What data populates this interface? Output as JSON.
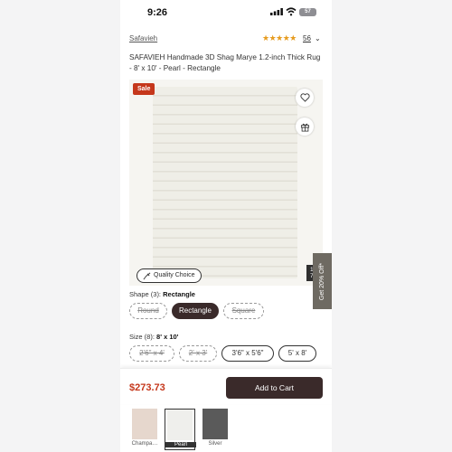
{
  "status_bar": {
    "time": "9:26",
    "battery": "57"
  },
  "product": {
    "brand": "Safavieh",
    "rating_stars": "★★★★★",
    "review_count": "56",
    "title": "SAFAVIEH Handmade 3D Shag Marye 1.2-inch Thick Rug - 8' x 10' - Pearl - Rectangle",
    "sale_badge": "Sale",
    "quality_badge": "Quality Choice",
    "image_counter": "1 / 7",
    "promo_tab": "Get 20% Off*"
  },
  "shape": {
    "label": "Shape (3):",
    "selected": "Rectangle",
    "options": [
      "Round",
      "Rectangle",
      "Square"
    ]
  },
  "size": {
    "label": "Size (8):",
    "selected": "8' x 10'",
    "options": [
      "2'6\" x 4'",
      "2' x 3'",
      "3'6\" x 5'6\"",
      "5' x 8'"
    ]
  },
  "cart": {
    "price": "$273.73",
    "button": "Add to Cart"
  },
  "color_swatches": [
    {
      "label": "Champa…",
      "color": "#e6d7cd"
    },
    {
      "label": "Pearl",
      "color": "#efefec"
    },
    {
      "label": "Silver",
      "color": "#5a5a5a"
    }
  ],
  "colors": {
    "accent": "#c5371b",
    "button": "#3a2a2a",
    "stars": "#e69b1e"
  }
}
